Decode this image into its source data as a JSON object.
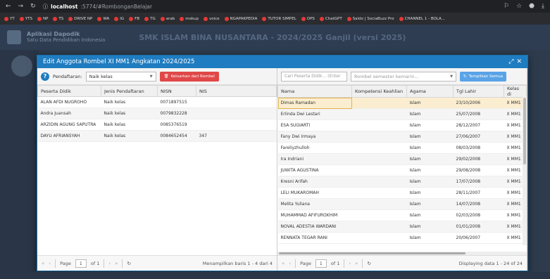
{
  "browser": {
    "host": "localhost",
    "path": ":5774/#RombonganBelajar",
    "bookmarks": [
      "YT",
      "YTS",
      "NP",
      "TS",
      "DRIVE NP",
      "WA",
      "IG",
      "FB",
      "TG",
      "arab",
      "mokup",
      "voice",
      "NGAPAKPEDIA",
      "TUTOR SIMPEL",
      "OPS",
      "ChatGPT",
      "Saldo | SociaBuzz Pro",
      "CHANNEL 1 - BOLA..."
    ]
  },
  "app": {
    "name": "Aplikasi Dapodik",
    "subname": "Satu Data Pendidikan Indonesia",
    "title": "SMK ISLAM BINA NUSANTARA - 2024/2025 Ganjil (versi 2025)"
  },
  "modal": {
    "title": "Edit Anggota Rombel XI MM1 Angkatan 2024/2025",
    "left": {
      "label_pendaftaran": "Pendaftaran:",
      "select_value": "Naik kelas",
      "remove_button": "Keluarkan dari Rombel",
      "columns": [
        "Peserta Didik",
        "Jenis Pendaftaran",
        "NISN",
        "NIS"
      ],
      "rows": [
        [
          "ALAN AFDI NUGROHO",
          "Naik kelas",
          "0071897515",
          ""
        ],
        [
          "Andra Juansah",
          "Naik kelas",
          "0079832228",
          ""
        ],
        [
          "ARZIDIN AGUNG SAPUTRA",
          "Naik kelas",
          "0085376519",
          ""
        ],
        [
          "DAYU AFRIANSYAH",
          "Naik kelas",
          "0084652454",
          "347"
        ]
      ],
      "pager": {
        "page_label": "Page",
        "page": "1",
        "of": "of 1",
        "info": "Menampilkan baris 1 - 4 dari 4"
      }
    },
    "right": {
      "search_placeholder": "Cari Peserta Didik... (Enter",
      "semester_placeholder": "Rombel semester kemarin...",
      "add_button": "Tampilkan Semua",
      "columns": [
        "Nama",
        "Kompetensi Keahlian",
        "Agama",
        "Tgl Lahir",
        "Kelas di"
      ],
      "rows": [
        [
          "Dimas Ramadan",
          "",
          "Islam",
          "23/10/2006",
          "X MM1"
        ],
        [
          "Erlinda Dwi Lestari",
          "",
          "Islam",
          "25/07/2008",
          "X MM1"
        ],
        [
          "ESA SUGIARTI",
          "",
          "Islam",
          "28/12/2007",
          "X MM1"
        ],
        [
          "Fany Dwi Irmaya",
          "",
          "Islam",
          "27/06/2007",
          "X MM1"
        ],
        [
          "Fareliyzhulloh",
          "",
          "Islam",
          "08/03/2008",
          "X MM1"
        ],
        [
          "Ira Indriani",
          "",
          "Islam",
          "29/02/2008",
          "X MM1"
        ],
        [
          "JUWITA AGUSTINA",
          "",
          "Islam",
          "29/08/2008",
          "X MM1"
        ],
        [
          "Kresni Arifah",
          "",
          "Islam",
          "17/07/2008",
          "X MM1"
        ],
        [
          "LELI MUKAROMAH",
          "",
          "Islam",
          "28/11/2007",
          "X MM1"
        ],
        [
          "Melita Yuliana",
          "",
          "Islam",
          "14/07/2008",
          "X MM1"
        ],
        [
          "MUHAMMAD AFIFUROKHIM",
          "",
          "Islam",
          "02/03/2008",
          "X MM1"
        ],
        [
          "NOVAL ADESTIA WARDANI",
          "",
          "Islam",
          "01/01/2008",
          "X MM1"
        ],
        [
          "RENNATA TEGAR RANI",
          "",
          "Islam",
          "20/06/2007",
          "X MM1"
        ]
      ],
      "pager": {
        "page_label": "Page",
        "page": "1",
        "of": "of 1",
        "info": "Displaying data 1 - 24 of 24"
      }
    }
  }
}
